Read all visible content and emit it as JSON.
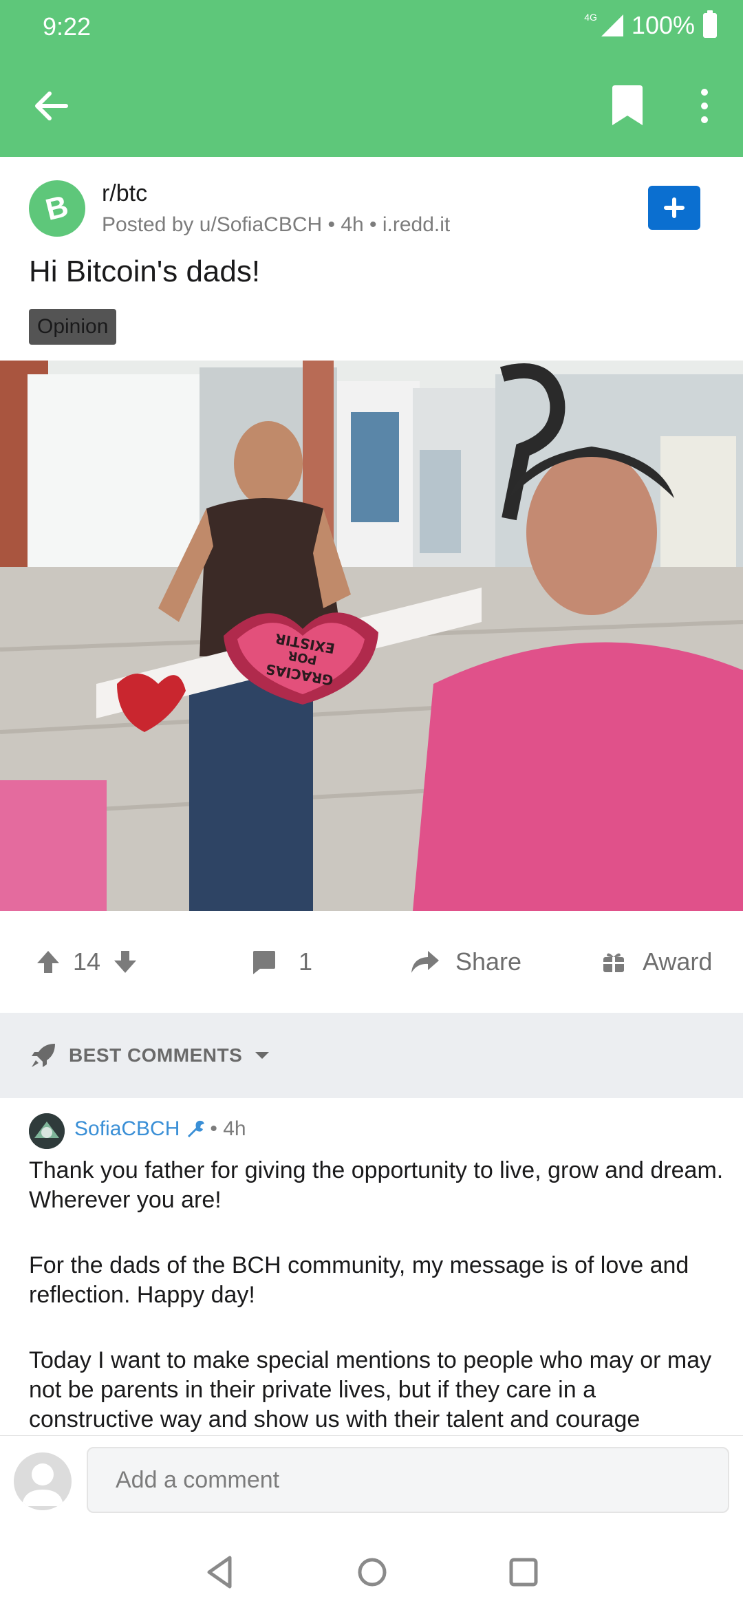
{
  "status_bar": {
    "time": "9:22",
    "network": "4G",
    "battery": "100%"
  },
  "toolbar": {
    "back_icon": "arrow-left-icon",
    "bookmark_icon": "bookmark-icon",
    "more_icon": "more-vertical-icon"
  },
  "post": {
    "subreddit": "r/btc",
    "subreddit_icon": "bitcoin-cash-icon",
    "avatar_letter": "B",
    "meta": "Posted by u/SofiaCBCH • 4h • i.redd.it",
    "title": "Hi Bitcoin's dads!",
    "flair": "Opinion",
    "image_sign_text": [
      "GRACIAS",
      "POR",
      "EXISTIR"
    ]
  },
  "actions": {
    "score": "14",
    "comments": "1",
    "share": "Share",
    "award": "Award"
  },
  "sort": {
    "label": "BEST COMMENTS"
  },
  "comment": {
    "author": "SofiaCBCH",
    "time": "• 4h",
    "paragraphs": [
      "Thank you father for giving the opportunity to live, grow and dream. Wherever you are!",
      "For the dads of the BCH community, my message is of love and reflection. Happy day!",
      "Today I want to make special mentions to people who may or may not be parents in their private lives, but if they care in a constructive way and show us with their talent and courage"
    ]
  },
  "add_comment": {
    "placeholder": "Add a comment"
  },
  "colors": {
    "accent": "#5ec77a",
    "join": "#0b6fd0",
    "author": "#3a8fd6"
  }
}
